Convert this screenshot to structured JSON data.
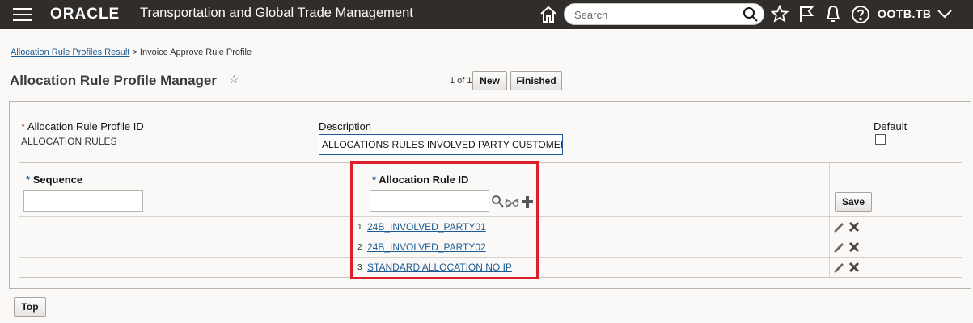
{
  "header": {
    "logo": "ORACLE",
    "app_title": "Transportation and Global Trade Management",
    "search_placeholder": "Search",
    "user": "OOTB.TB",
    "icons": [
      "hamburger-menu-icon",
      "home-icon",
      "search-icon",
      "star-icon",
      "flag-icon",
      "bell-icon",
      "help-icon",
      "chevron-down-icon"
    ]
  },
  "breadcrumb": {
    "link": "Allocation Rule Profiles Result",
    "separator": ">",
    "current": "Invoice Approve Rule Profile"
  },
  "page": {
    "title": "Allocation Rule Profile Manager",
    "pager": "1 of 1",
    "new_label": "New",
    "finished_label": "Finished"
  },
  "form": {
    "profile_id_label": "Allocation Rule Profile ID",
    "profile_id_value": "ALLOCATION RULES",
    "description_label": "Description",
    "description_value": "ALLOCATIONS RULES INVOLVED PARTY CUSTOMER",
    "default_label": "Default",
    "default_checked": false,
    "required_marker": "*"
  },
  "grid": {
    "sequence_label": "Sequence",
    "rule_id_label": "Allocation Rule ID",
    "save_label": "Save",
    "rows": [
      {
        "num": "1",
        "rule_id": "24B_INVOLVED_PARTY01"
      },
      {
        "num": "2",
        "rule_id": "24B_INVOLVED_PARTY02"
      },
      {
        "num": "3",
        "rule_id": "STANDARD ALLOCATION NO IP"
      }
    ]
  },
  "footer": {
    "top_label": "Top"
  },
  "colors": {
    "header_bg": "#312d2a",
    "link": "#1b5b96",
    "required": "#c74634",
    "highlight": "#d9202b"
  }
}
